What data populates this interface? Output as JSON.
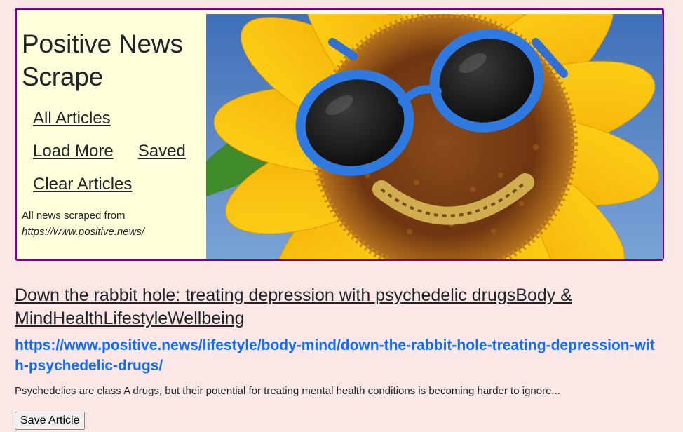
{
  "header": {
    "title": "Positive News Scrape",
    "nav": {
      "all_articles": "All Articles",
      "load_more": "Load More",
      "saved": "Saved",
      "clear_articles": "Clear Articles"
    },
    "credit_text": "All news scraped from",
    "credit_url": "https://www.positive.news/",
    "hero_image": "smiling-sunflower-with-blue-sunglasses"
  },
  "articles": [
    {
      "title": "Down the rabbit hole: treating depression with psychedelic drugsBody & MindHealthLifestyleWellbeing",
      "url": "https://www.positive.news/lifestyle/body-mind/down-the-rabbit-hole-treating-depression-with-psychedelic-drugs/",
      "summary": "Psychedelics are class A drugs, but their potential for treating mental health conditions is becoming harder to ignore...",
      "save_label": "Save Article"
    }
  ],
  "colors": {
    "page_bg": "#fce7e7",
    "hero_bg": "#ffffdc",
    "hero_border": "#800080",
    "link": "#0d6efd"
  }
}
